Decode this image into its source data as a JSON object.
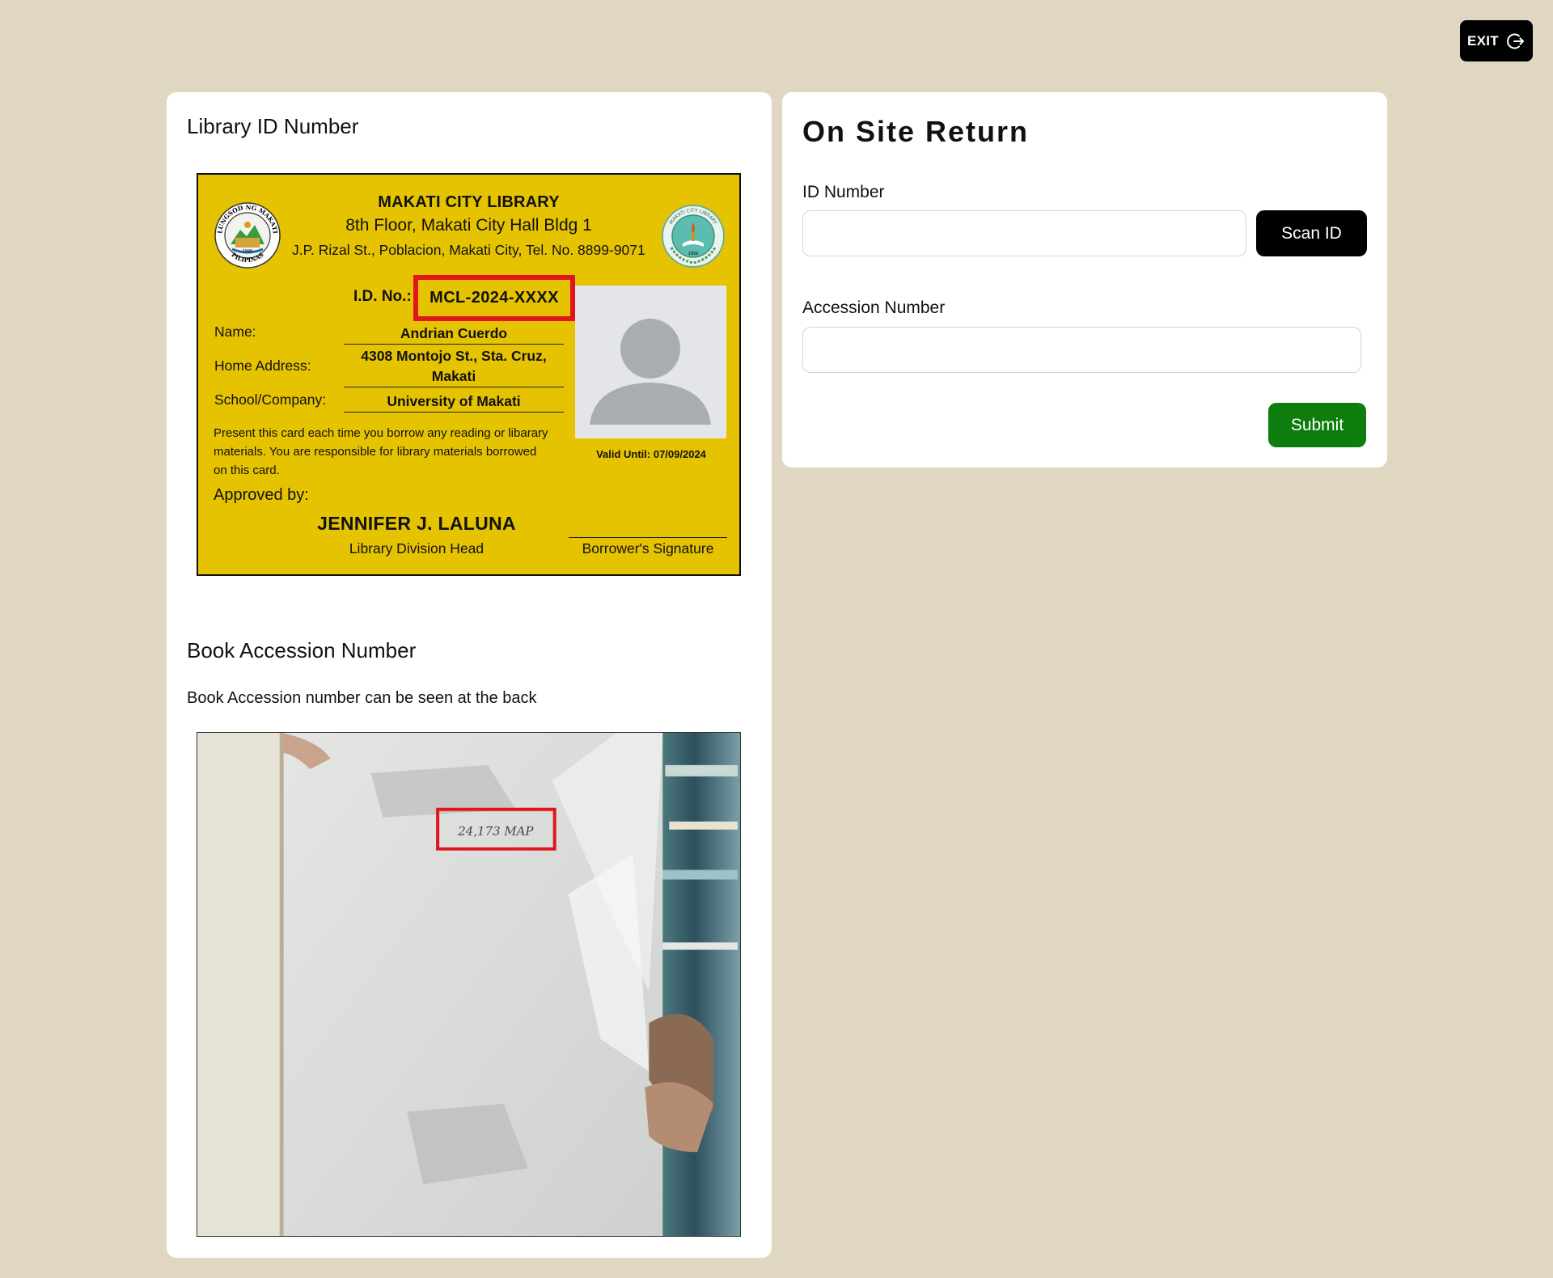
{
  "header": {
    "exit_label": "EXIT",
    "exit_icon": "logout-icon"
  },
  "left_panel": {
    "library_id_heading": "Library ID Number",
    "id_card": {
      "library_name": "MAKATI CITY LIBRARY",
      "floor": "8th Floor, Makati City Hall Bldg 1",
      "address": "J.P. Rizal St., Poblacion, Makati City, Tel. No. 8899-9071",
      "id_no_label": "I.D. No.:",
      "id_no_value": "MCL-2024-XXXX",
      "name_label": "Name:",
      "name_value": "Andrian Cuerdo",
      "home_address_label": "Home Address:",
      "home_address_value": "4308 Montojo St., Sta. Cruz, Makati",
      "school_label": "School/Company:",
      "school_value": "University of Makati",
      "note": "Present this card each time you borrow any reading or libarary materials. You are responsible for library materials borrowed on this card.",
      "valid_until": "Valid Until: 07/09/2024",
      "approved_by_label": "Approved by:",
      "signer_name": "JENNIFER J. LALUNA",
      "signer_role": "Library Division Head",
      "signature_label": "Borrower's Signature",
      "seal_left_text": "LUNGSOD NG MAKATI",
      "seal_left_bottom": "PILIPINAS",
      "seal_left_year": "1996",
      "seal_right_text": "MAKATI CITY LIBRARY",
      "seal_right_year": "1956",
      "highlight_color": "#e0161f",
      "card_color": "#e6c300"
    },
    "accession_heading": "Book Accession Number",
    "accession_hint": "Book Accession number can be seen at the back",
    "accession_sample": "24,173 MAP"
  },
  "form": {
    "title": "On Site Return",
    "id_label": "ID Number",
    "id_value": "",
    "scan_label": "Scan ID",
    "accession_label": "Accession Number",
    "accession_value": "",
    "submit_label": "Submit",
    "submit_color": "#0d7d0d"
  }
}
